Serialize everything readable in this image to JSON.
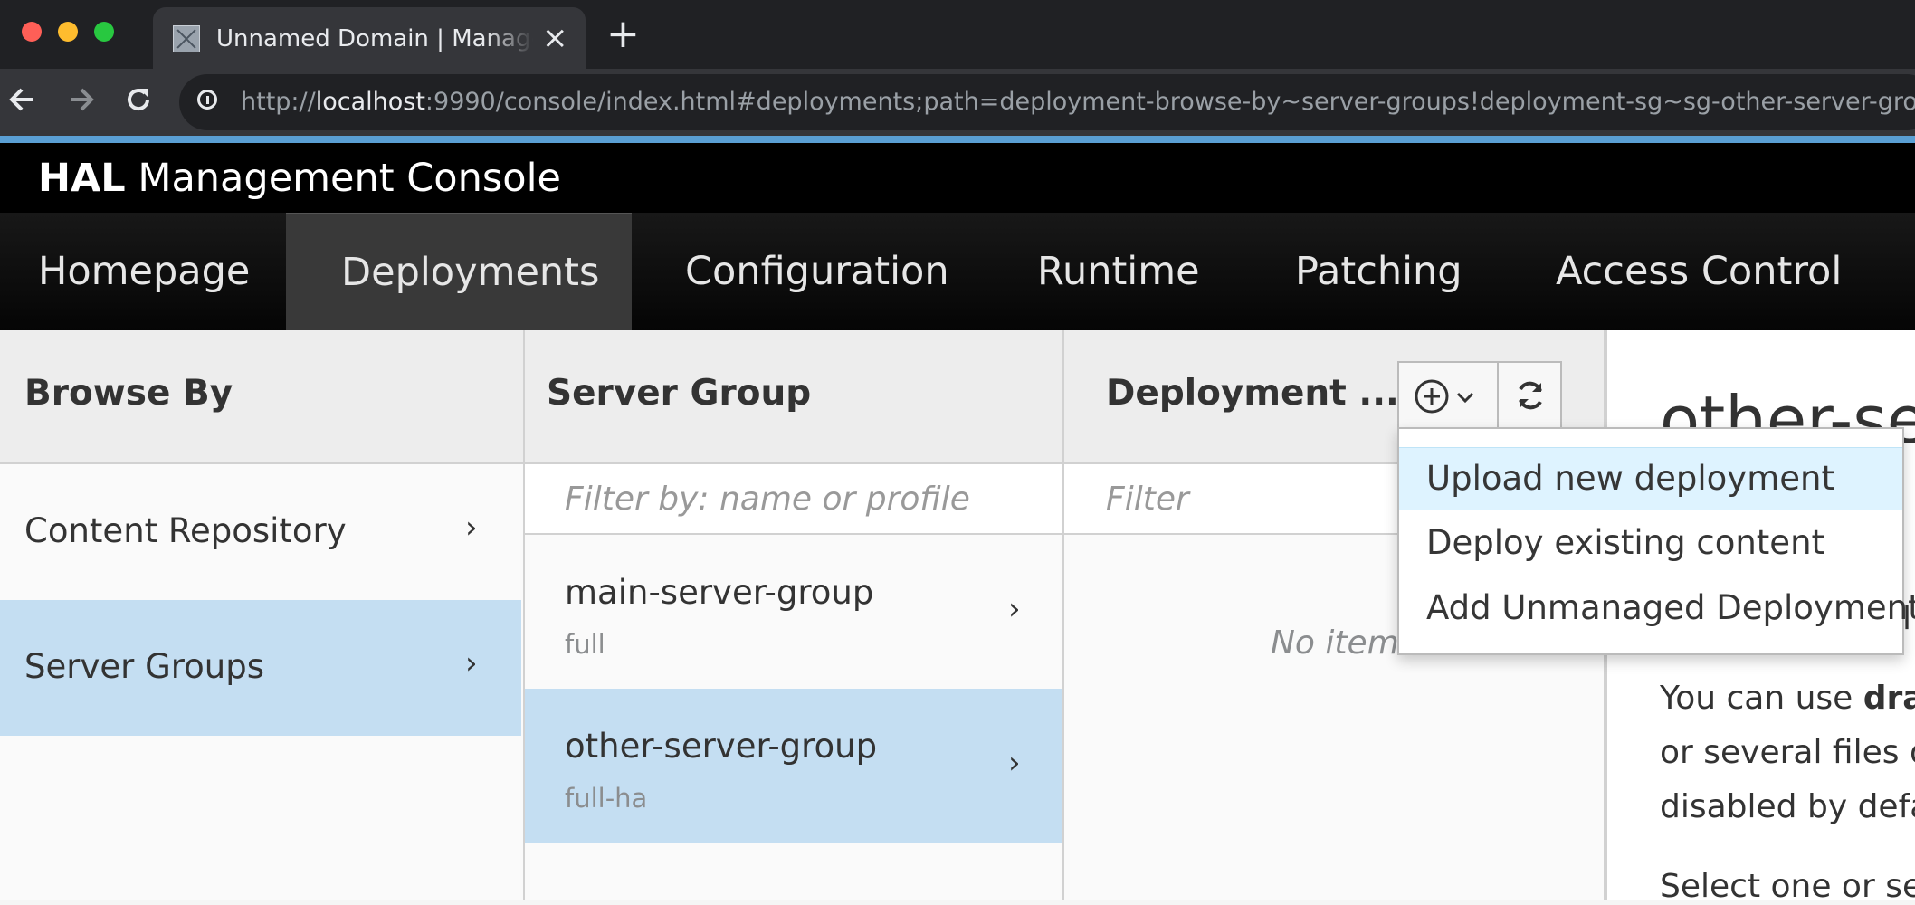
{
  "browser": {
    "tab_title": "Unnamed Domain | Management Console",
    "tab_close": "×",
    "new_tab": "+",
    "url_prefix": "http://",
    "url_host": "localhost",
    "url_rest": ":9990/console/index.html#deployments;path=deployment-browse-by~server-groups!deployment-sg~sg-other-server-group"
  },
  "header": {
    "brand_bold": "HAL",
    "brand_rest": "Management Console"
  },
  "nav": {
    "items": [
      "Homepage",
      "Deployments",
      "Configuration",
      "Runtime",
      "Patching",
      "Access Control"
    ],
    "active": "Deployments"
  },
  "browse_by": {
    "title": "Browse By",
    "items": [
      {
        "label": "Content Repository",
        "selected": false
      },
      {
        "label": "Server Groups",
        "selected": true
      }
    ]
  },
  "server_group": {
    "title": "Server Group",
    "filter_placeholder": "Filter by: name or profile",
    "items": [
      {
        "name": "main-server-group",
        "profile": "full",
        "selected": false
      },
      {
        "name": "other-server-group",
        "profile": "full-ha",
        "selected": true
      }
    ]
  },
  "deployment": {
    "title": "Deployment ...",
    "filter_placeholder": "Filter",
    "empty_text": "No items",
    "dropdown": {
      "items": [
        "Upload new deployment",
        "Deploy existing content",
        "Add Unmanaged Deployment"
      ],
      "active_index": 0
    }
  },
  "preview": {
    "title": "other-se",
    "partial_line": "l",
    "lines": [
      {
        "before": "You can use ",
        "bold": "drag"
      },
      {
        "before": "or several files or",
        "bold": ""
      },
      {
        "before": "disabled by defau",
        "bold": ""
      },
      {
        "before": "Select one or sev",
        "bold": ""
      }
    ]
  },
  "colors": {
    "accent": "#5a9fd4",
    "selected": "#c4def2",
    "dropdown_active": "#def3ff"
  },
  "chevron": "›"
}
